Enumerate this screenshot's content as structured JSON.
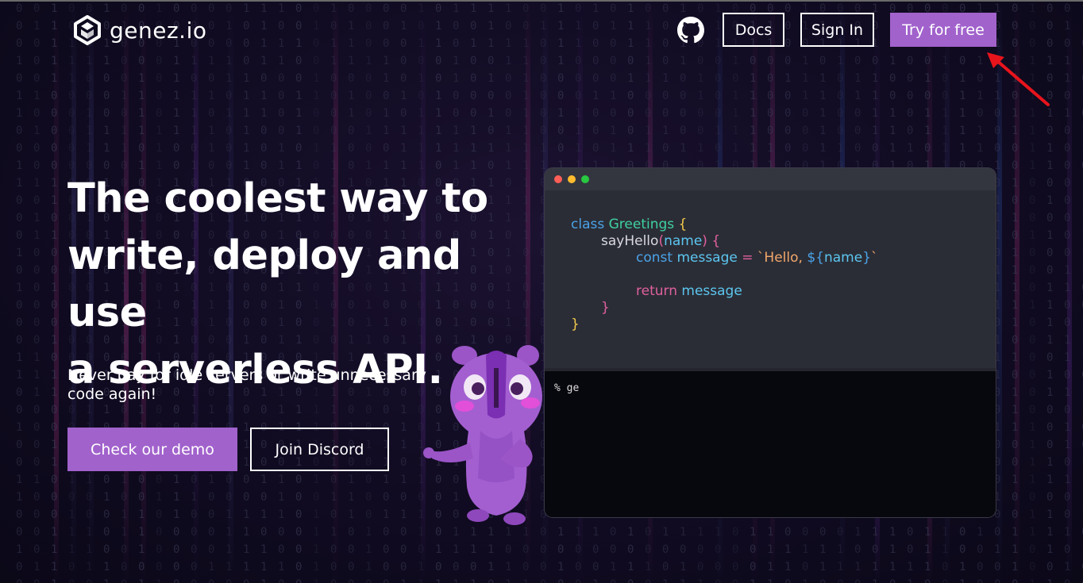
{
  "header": {
    "logo_text": "genez.io",
    "nav": {
      "docs_label": "Docs",
      "signin_label": "Sign In",
      "try_label": "Try for free"
    }
  },
  "hero": {
    "title_line1": "The coolest way to",
    "title_line2": "write, deploy and use",
    "title_line3": "a serverless API.",
    "subtitle": "Never pay for idle servers or write unnecessary code again!",
    "demo_label": "Check our demo",
    "discord_label": "Join Discord"
  },
  "editor": {
    "code": {
      "l1_kw": "class",
      "l1_name": "Greetings",
      "l1_brace": "{",
      "l2_fn": "sayHello",
      "l2_paren_open": "(",
      "l2_param": "name",
      "l2_paren_close": ")",
      "l2_brace": "{",
      "l3_kw": "const",
      "l3_var": "message",
      "l3_eq": "=",
      "l3_str1": "`Hello, ",
      "l3_interp_open": "${",
      "l3_interp_var": "name",
      "l3_interp_close": "}",
      "l3_str2": "`",
      "l5_kw": "return",
      "l5_var": "message",
      "l6_brace": "}",
      "l7_brace": "}"
    },
    "terminal_text": "% ge"
  },
  "colors": {
    "accent": "#a162cc",
    "background": "#0e0a1c",
    "arrow": "#e8141c"
  },
  "icons": [
    "genezio-logo-icon",
    "github-icon",
    "arrow-annotation"
  ]
}
